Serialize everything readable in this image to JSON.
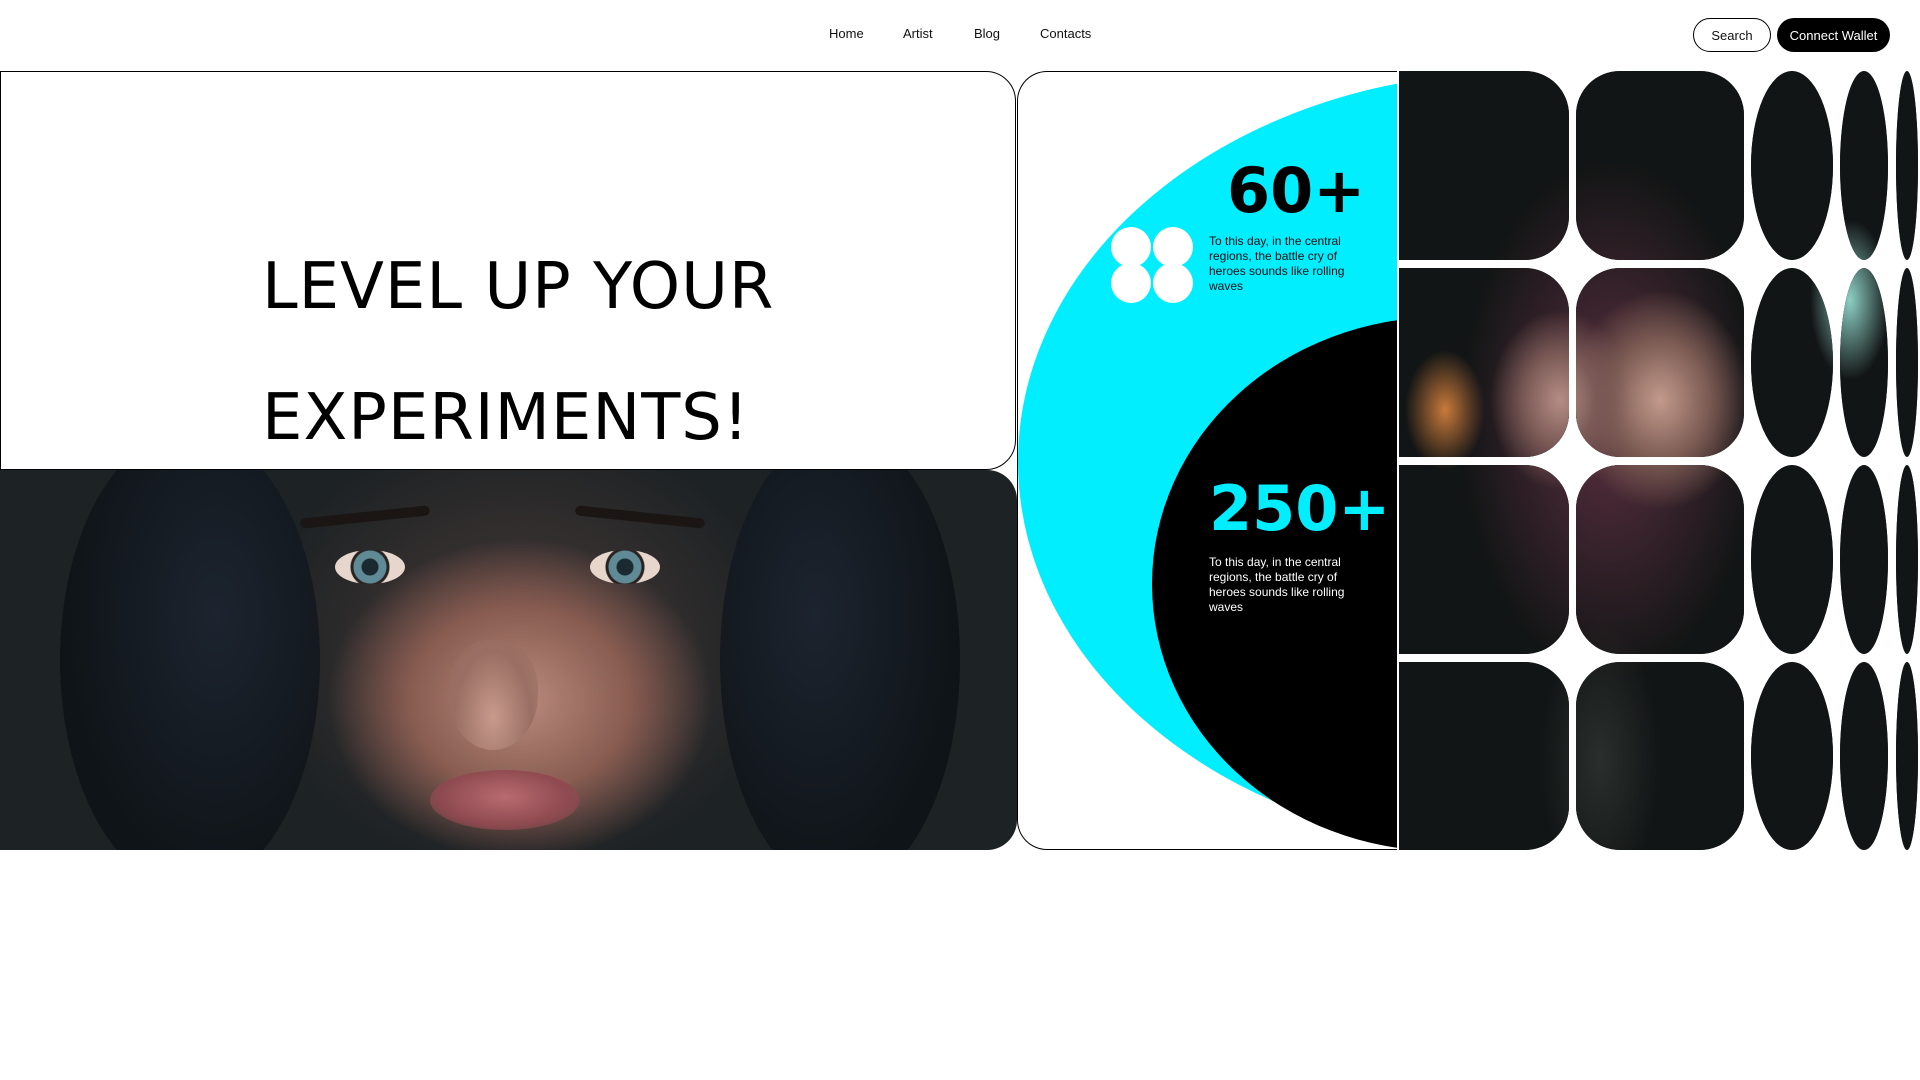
{
  "nav": {
    "links": [
      "Home",
      "Artist",
      "Blog",
      "Contacts"
    ],
    "search_label": "Search",
    "wallet_label": "Connect Wallet"
  },
  "hero": {
    "title_line1": "LEVEL UP YOUR",
    "title_line2": "EXPERIMENTS!"
  },
  "stats": [
    {
      "value": "60+",
      "description": "To this day, in the central regions, the battle cry of heroes sounds like rolling waves"
    },
    {
      "value": "250+",
      "description": "To this day, in the central regions, the battle cry of heroes sounds like rolling waves"
    }
  ],
  "colors": {
    "accent": "#00eeff",
    "dark": "#000000",
    "background": "#ffffff"
  },
  "icons": {
    "stats_icon": "four-circles-flower-icon"
  }
}
